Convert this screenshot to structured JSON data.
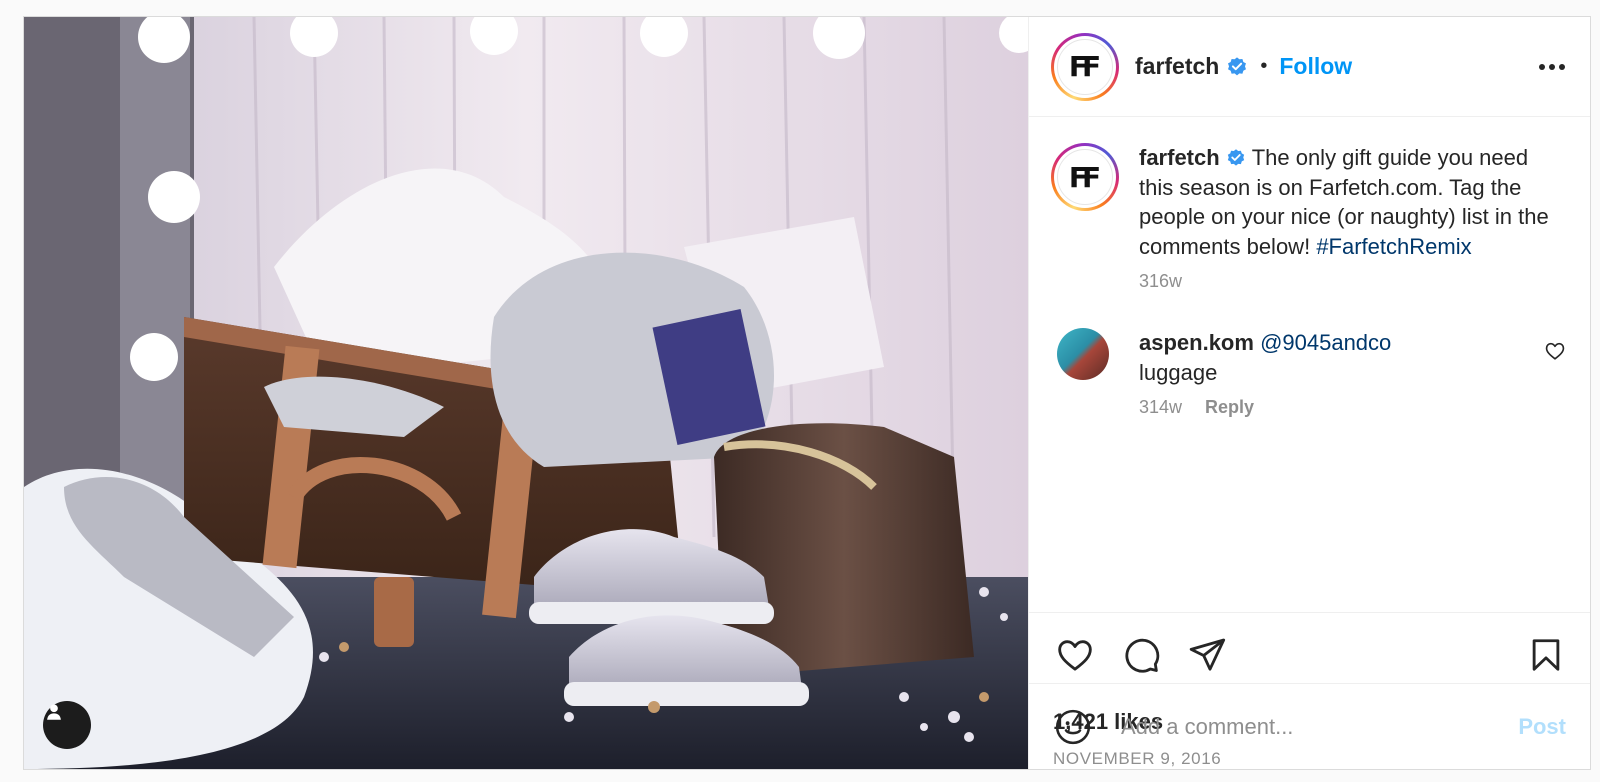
{
  "post": {
    "image_alt": "Gift guide still life: monogram suitcase, grey knitwear, navy notebook, silver platform sneakers and leather tote before a vanity mirror",
    "author": {
      "username": "farfetch",
      "avatar_initials": "FF",
      "verified_icon": "verified-badge-icon"
    },
    "follow_label": "Follow",
    "separator": "•",
    "caption": {
      "username": "farfetch",
      "text": "The only gift guide you need this season is on Farfetch.com. Tag the people on your nice (or naughty) list in the comments below!",
      "hashtag": "#FarfetchRemix",
      "age": "316w"
    },
    "comments": [
      {
        "username": "aspen.kom",
        "mention": "@9045andco",
        "text": "luggage",
        "age": "314w",
        "reply_label": "Reply"
      }
    ],
    "likes": "1,421 likes",
    "date": "NOVEMBER 9, 2016",
    "comment_input": {
      "placeholder": "Add a comment...",
      "value": ""
    },
    "post_label": "Post"
  },
  "colors": {
    "link_blue": "#0095f6",
    "hashtag_navy": "#00376b",
    "muted": "#8e8e8e",
    "post_disabled": "#b2dffc"
  }
}
